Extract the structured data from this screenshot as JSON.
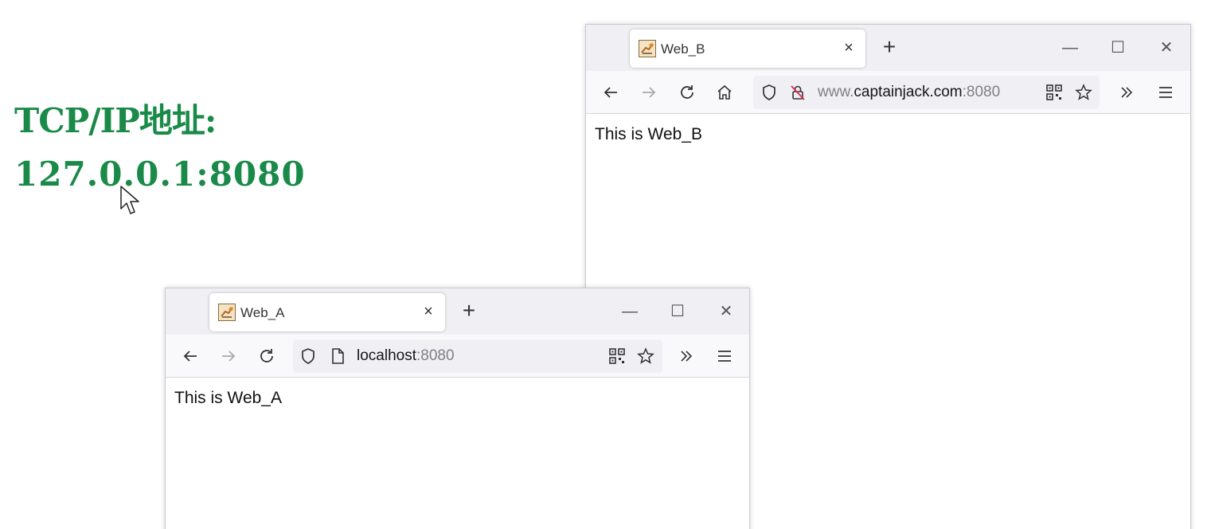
{
  "slide": {
    "title": "TCP/IP地址:",
    "address": "127.0.0.1:8080"
  },
  "window_b": {
    "tab_title": "Web_B",
    "url_prefix": "www.",
    "url_host": "captainjack.com",
    "url_port": ":8080",
    "page_text": "This is Web_B"
  },
  "window_a": {
    "tab_title": "Web_A",
    "url_host": "localhost",
    "url_port": ":8080",
    "page_text": "This is Web_A"
  },
  "controls": {
    "close_glyph": "×",
    "newtab_glyph": "+",
    "minimize_glyph": "—",
    "maximize_glyph": "☐",
    "window_close_glyph": "✕"
  },
  "icons": [
    "back-arrow-icon",
    "forward-arrow-icon",
    "reload-icon",
    "home-icon",
    "shield-icon",
    "insecure-lock-icon",
    "page-icon",
    "qr-code-icon",
    "star-icon",
    "overflow-chevron-icon",
    "hamburger-menu-icon",
    "tomcat-favicon-icon",
    "mouse-cursor-icon"
  ],
  "colors": {
    "heading_green": "#1a8a48",
    "toolbar_bg": "#f9f9fb",
    "tabstrip_bg": "#f0f0f4"
  }
}
